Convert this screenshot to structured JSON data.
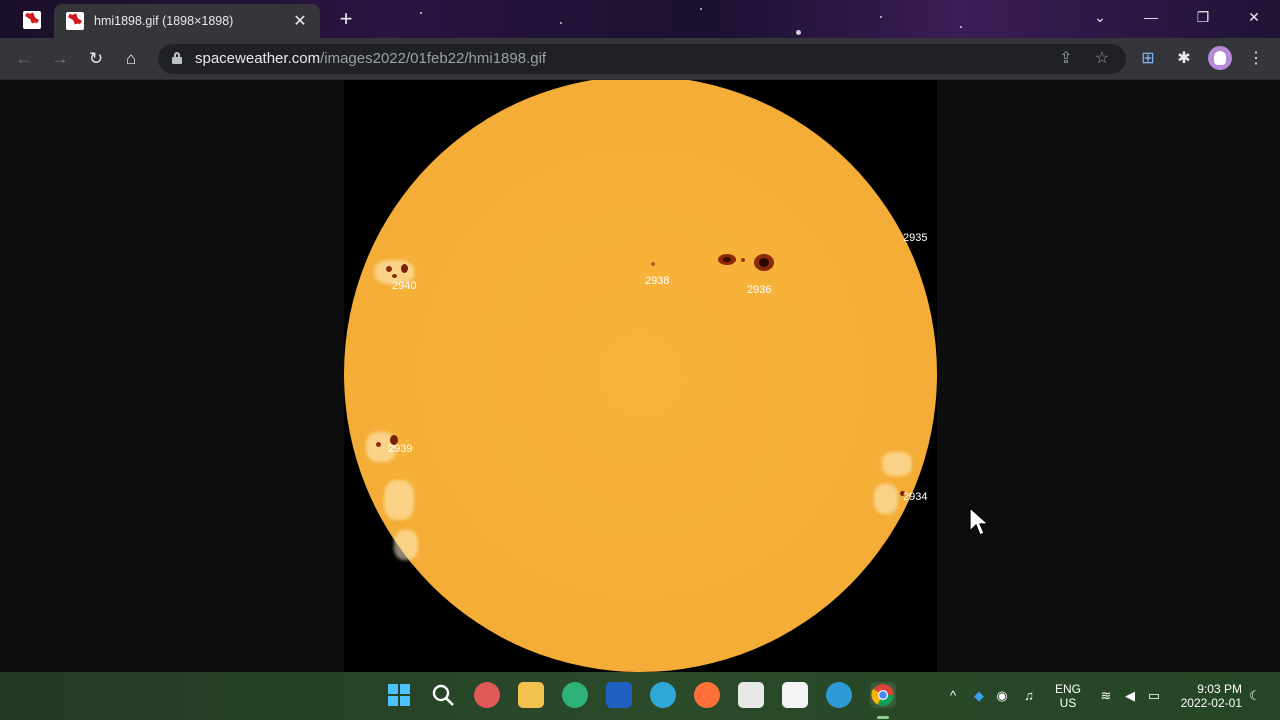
{
  "browser": {
    "tabs": [
      {
        "title": "",
        "pinned": true
      },
      {
        "title": "hmi1898.gif (1898×1898)",
        "active": true
      }
    ],
    "new_tab_glyph": "+",
    "close_glyph": "✕",
    "window_controls": {
      "tab_search": "⌄",
      "minimize": "—",
      "restore": "❐",
      "close": "✕"
    },
    "nav": {
      "back": "←",
      "forward": "→",
      "reload": "↻",
      "home": "⌂"
    },
    "address": {
      "domain": "spaceweather.com",
      "path": "/images2022/01feb22/hmi1898.gif"
    },
    "omnibox_icons": {
      "share": "⇪",
      "bookmark": "☆"
    },
    "extensions": {
      "ext1": "⊞",
      "puzzle": "✱",
      "menu": "⋮"
    }
  },
  "image": {
    "active_regions": [
      {
        "label": "2935"
      },
      {
        "label": "2940"
      },
      {
        "label": "2938"
      },
      {
        "label": "2936"
      },
      {
        "label": "2939"
      },
      {
        "label": "2934"
      }
    ]
  },
  "taskbar": {
    "apps": [
      "start",
      "search",
      "app-red",
      "file-explorer",
      "edge-dev",
      "app-blue",
      "edge-canary",
      "firefox",
      "store",
      "app-white",
      "edge",
      "chrome"
    ],
    "tray": {
      "chevron": "^",
      "lang_line1": "ENG",
      "lang_line2": "US",
      "time": "9:03 PM",
      "date": "2022-02-01"
    }
  },
  "colors": {
    "sun": "#f5b038",
    "tab_bg": "#35363a",
    "omnibox_bg": "#202124"
  }
}
